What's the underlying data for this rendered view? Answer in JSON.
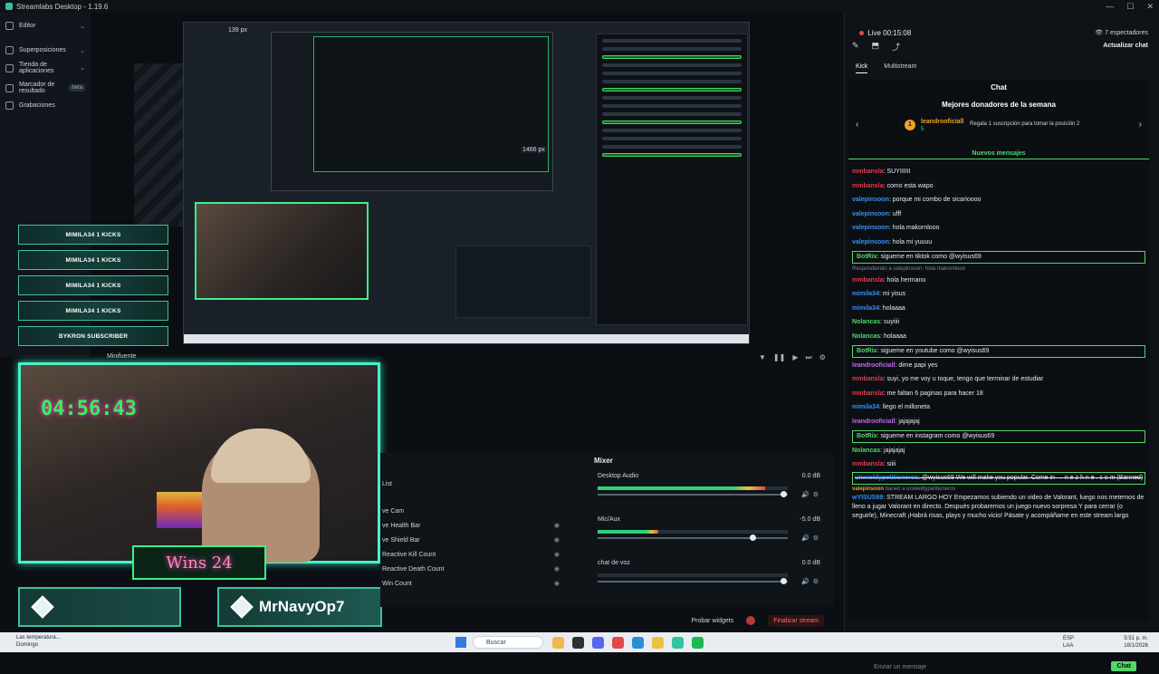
{
  "window": {
    "title": "Streamlabs Desktop - 1.19.6",
    "controls": [
      "—",
      "☐",
      "✕"
    ]
  },
  "sidebar": {
    "items": [
      {
        "label": "Editor",
        "icon": "editor-icon",
        "chevron": "⌄"
      },
      {
        "label": "Superposiciones",
        "icon": "overlays-icon",
        "chevron": "⌄"
      },
      {
        "label": "Tienda de aplicaciones",
        "icon": "store-icon",
        "chevron": "⌄"
      },
      {
        "label": "Marcador de resultado",
        "icon": "scoreboard-icon",
        "badge": "beta"
      },
      {
        "label": "Grabaciones",
        "icon": "recordings-icon"
      }
    ]
  },
  "preview": {
    "px_label_1": "139 px",
    "px_label_2": "1466 px"
  },
  "leaderboard": [
    "MIMILA34 1 KICKS",
    "MIMILA34 1 KICKS",
    "MIMILA34 1 KICKS",
    "MIMILA34 1 KICKS",
    "BYKRON SUBSCRIBER"
  ],
  "overlay": {
    "source_name": "Minifuente",
    "timer": "04:56:43",
    "wins": "Wins 24",
    "streamer": "MrNavyOp7"
  },
  "sources": [
    "List",
    "ve Cam",
    "ve Health Bar",
    "ve Shield Bar",
    "Reactive Kill Count",
    "Reactive Death Count",
    "Win Count"
  ],
  "mixer": {
    "title": "Mixer",
    "tracks": [
      {
        "name": "Desktop Audio",
        "db": "0.0 dB",
        "level": 0.88,
        "volume": 0.98
      },
      {
        "name": "Mic/Aux",
        "db": "-5.0 dB",
        "level": 0.32,
        "volume": 0.82
      },
      {
        "name": "chat de voz",
        "db": "0.0 dB",
        "level": 0.0,
        "volume": 0.98
      }
    ]
  },
  "bottom_bar": {
    "test_widgets": "Probar widgets",
    "end_stream": "Finalizar stream"
  },
  "chat": {
    "live": "Live",
    "time": "00:15:08",
    "viewers": "7 espectadores",
    "update": "Actualizar chat",
    "tabs": [
      "Kick",
      "Multistream"
    ],
    "title": "Chat",
    "donors_title": "Mejores donadores de la semana",
    "donor": {
      "rank": "1",
      "name": "leandrooficiall",
      "amount": "5",
      "hint": "Regala 1 suscripción para tomar la posición 2"
    },
    "new_messages": "Nuevos mensajes",
    "messages": [
      {
        "user": "mmbansla",
        "color": "#e23b4a",
        "text": ": SUYIIIIII"
      },
      {
        "user": "mmbansla",
        "color": "#e23b4a",
        "text": ": como esta wapo"
      },
      {
        "user": "valepinsoon",
        "color": "#3a8ef0",
        "text": ": porque mi combo de sicarioooo"
      },
      {
        "user": "valepinsoon",
        "color": "#3a8ef0",
        "text": ": ufff"
      },
      {
        "user": "valepinsoon",
        "color": "#3a8ef0",
        "text": ": hola makornlooo"
      },
      {
        "user": "valepinsoon",
        "color": "#3a8ef0",
        "text": ": hola mi yuuuu"
      },
      {
        "user": "BotRix",
        "color": "#53d769",
        "text": ": sigueme en tiktok como @wyisus69",
        "type": "bot"
      },
      {
        "user": "",
        "color": "#7d8791",
        "text": "Respondiendo a valepinsoon: hola makornlooo",
        "type": "reply"
      },
      {
        "user": "mmbansla",
        "color": "#e23b4a",
        "text": ": hola hermano"
      },
      {
        "user": "mimila34",
        "color": "#3a8ef0",
        "text": ": mi yisus"
      },
      {
        "user": "mimila34",
        "color": "#3a8ef0",
        "text": ": holaaaa"
      },
      {
        "user": "Nolancas",
        "color": "#53d769",
        "text": ": suyiiii"
      },
      {
        "user": "Nolancas",
        "color": "#53d769",
        "text": ": holaaaa"
      },
      {
        "user": "BotRix",
        "color": "#53d769",
        "text": ": sigueme en youtube como @wyisus69",
        "type": "bot"
      },
      {
        "user": "leandrooficiall",
        "color": "#c36ae8",
        "text": ": dime papi yes"
      },
      {
        "user": "mmbansla",
        "color": "#e23b4a",
        "text": ": suyi, yo me voy u toque, tengo que terminar de estudiar"
      },
      {
        "user": "mmbansla",
        "color": "#e23b4a",
        "text": ": me faltan 6 paginas para hacer 18"
      },
      {
        "user": "mimila34",
        "color": "#3a8ef0",
        "text": ": llego el milloneta"
      },
      {
        "user": "leandrooficiall",
        "color": "#c36ae8",
        "text": ": jajajajaj"
      },
      {
        "user": "BotRix",
        "color": "#53d769",
        "text": ": sigueme en instagram como @wyisus69",
        "type": "bot"
      },
      {
        "user": "Nolancas",
        "color": "#53d769",
        "text": ": jajajajaj"
      },
      {
        "user": "mmbansla",
        "color": "#e23b4a",
        "text": ": siiii"
      },
      {
        "user": "unwieldypetitioneros",
        "color": "#3a8ef0",
        "text": ": @wyisus69 We will make you popular. Come in → n e z h n e . c o m (Banned)",
        "type": "banned"
      },
      {
        "user": "valepinsoon",
        "color": "#f0a028",
        "text": " baneó a unwieldypetitioneros",
        "type": "reply"
      },
      {
        "user": "wYISUS69",
        "color": "#3a8ef0",
        "text": ": STREAM LARGO HOY Empezamos subiendo un video de Valorant, luego nos metemos de lleno a jugar Valorant en directo. Después probaremos un juego nuevo sorpresa Y para cerrar (o seguirle), Minecraft ¡Habrá risas, plays y mucho vicio! Pásate y acompáñame en este stream largo",
        "type": "long"
      }
    ],
    "input_placeholder": "Enviar un mensaje",
    "send": "Chat"
  },
  "taskbar": {
    "weather": "Las temperatura...",
    "weather_sub": "Domingo",
    "search": "Buscar",
    "lang": "ESP",
    "lang_sub": "LAA",
    "time": "5:51 p. m.",
    "date": "18/1/2026"
  }
}
